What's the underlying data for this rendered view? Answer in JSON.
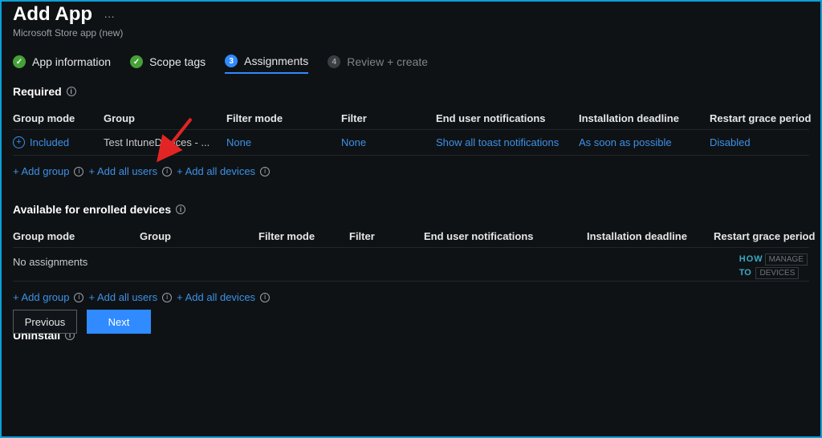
{
  "header": {
    "title": "Add App",
    "subtitle": "Microsoft Store app (new)"
  },
  "wizard": {
    "step1": "App information",
    "step2": "Scope tags",
    "step3_num": "3",
    "step3": "Assignments",
    "step4_num": "4",
    "step4": "Review + create"
  },
  "sections": {
    "required": "Required",
    "available": "Available for enrolled devices",
    "uninstall": "Uninstall"
  },
  "columns": {
    "group_mode": "Group mode",
    "group": "Group",
    "filter_mode": "Filter mode",
    "filter": "Filter",
    "notifications": "End user notifications",
    "deadline": "Installation deadline",
    "restart": "Restart grace period"
  },
  "row1": {
    "mode": "Included",
    "group": "Test IntuneDevices - ...",
    "filter_mode": "None",
    "filter": "None",
    "notifications": "Show all toast notifications",
    "deadline": "As soon as possible",
    "restart": "Disabled"
  },
  "available_empty": "No assignments",
  "adders": {
    "add_group": "+ Add group",
    "add_users": "+ Add all users",
    "add_devices": "+ Add all devices"
  },
  "footer": {
    "previous": "Previous",
    "next": "Next"
  },
  "watermark": {
    "how": "HOW",
    "to": "TO",
    "manage": "MANAGE",
    "devices": "DEVICES"
  }
}
